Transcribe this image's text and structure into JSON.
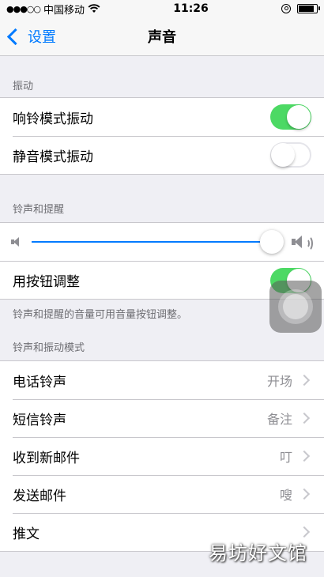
{
  "status_bar": {
    "signal": "●●●○○",
    "carrier": "中国移动",
    "time": "11:26"
  },
  "nav": {
    "back_label": "设置",
    "title": "声音"
  },
  "vibrate_section": {
    "header": "振动",
    "rows": [
      {
        "label": "响铃模式振动",
        "on": true
      },
      {
        "label": "静音模式振动",
        "on": false
      }
    ]
  },
  "ringer_section": {
    "header": "铃声和提醒",
    "volume_level": 0.96,
    "change_with_buttons": {
      "label": "用按钮调整",
      "on": true
    },
    "footer": "铃声和提醒的音量可用音量按钮调整。"
  },
  "patterns_section": {
    "header": "铃声和振动模式",
    "rows": [
      {
        "label": "电话铃声",
        "value": "开场"
      },
      {
        "label": "短信铃声",
        "value": "备注"
      },
      {
        "label": "收到新邮件",
        "value": "叮"
      },
      {
        "label": "发送邮件",
        "value": "嗖"
      },
      {
        "label": "推文",
        "value": ""
      }
    ]
  },
  "watermark": "易坊好文馆",
  "colors": {
    "accent": "#007aff",
    "toggle_on": "#4cd964",
    "background": "#efeff4"
  }
}
